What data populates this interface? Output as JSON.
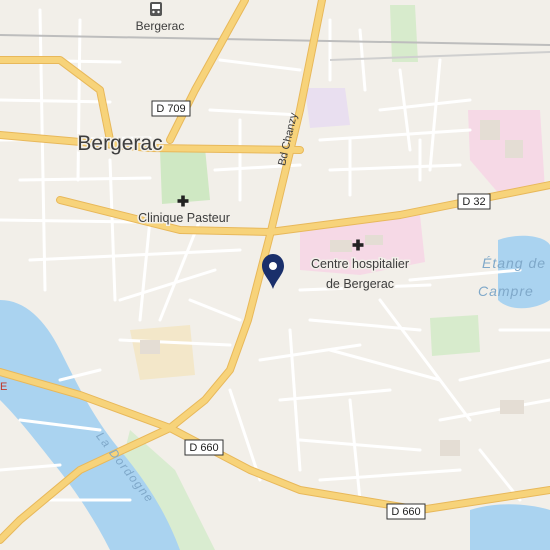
{
  "map": {
    "place_labels": {
      "bergerac_town": "Bergerac",
      "bergerac_station": "Bergerac",
      "clinique": "Clinique Pasteur",
      "hospital_line1": "Centre hospitalier",
      "hospital_line2": "de Bergerac",
      "street_chanzy": "Bd Chanzy",
      "river": "La Dordogne",
      "lake_line1": "Étang de",
      "lake_line2": "Campre",
      "edge_letter": "E"
    },
    "road_shields": {
      "d709": "D 709",
      "d32": "D 32",
      "d660_a": "D 660",
      "d660_b": "D 660"
    },
    "marker": {
      "name": "location-pin",
      "color": "#1a2f6b"
    },
    "colors": {
      "land": "#f2efe9",
      "water": "#aad3f0",
      "major_road": "#f7d37a",
      "minor_road": "#ffffff",
      "park": "#cfe8c3",
      "hospital_area": "#f6d9e6",
      "industrial": "#f3e7c9"
    }
  }
}
